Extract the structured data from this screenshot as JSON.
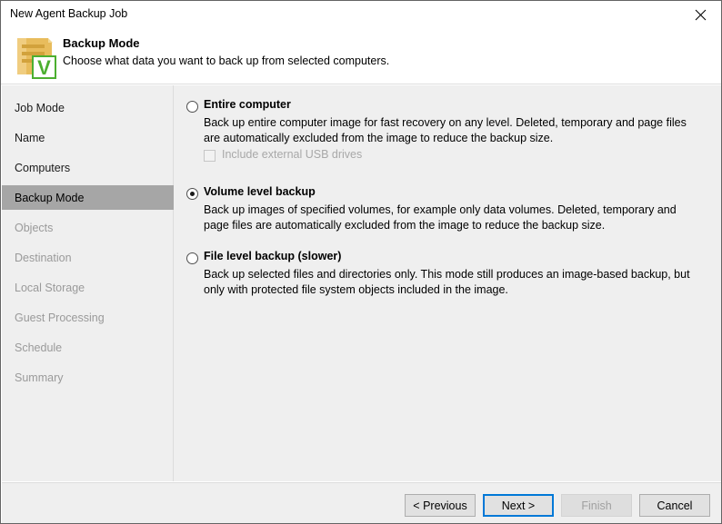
{
  "window": {
    "title": "New Agent Backup Job",
    "close_icon": "close-icon"
  },
  "header": {
    "icon": "document-veeam-icon",
    "title": "Backup Mode",
    "subtitle": "Choose what data you want to back up from selected computers."
  },
  "sidebar": {
    "items": [
      {
        "label": "Job Mode",
        "state": "done"
      },
      {
        "label": "Name",
        "state": "done"
      },
      {
        "label": "Computers",
        "state": "done"
      },
      {
        "label": "Backup Mode",
        "state": "active"
      },
      {
        "label": "Objects",
        "state": "upcoming"
      },
      {
        "label": "Destination",
        "state": "upcoming"
      },
      {
        "label": "Local Storage",
        "state": "upcoming"
      },
      {
        "label": "Guest Processing",
        "state": "upcoming"
      },
      {
        "label": "Schedule",
        "state": "upcoming"
      },
      {
        "label": "Summary",
        "state": "upcoming"
      }
    ]
  },
  "main": {
    "options": [
      {
        "id": "entire-computer",
        "title": "Entire computer",
        "description": "Back up entire computer image for fast recovery on any level. Deleted, temporary and page files are automatically excluded from the image to reduce the backup size.",
        "selected": false,
        "sub_checkbox": {
          "label": "Include external USB drives",
          "checked": false,
          "enabled": false
        }
      },
      {
        "id": "volume-level-backup",
        "title": "Volume level backup",
        "description": "Back up images of specified volumes, for example only data volumes. Deleted, temporary and page files are automatically excluded from the image to reduce the backup size.",
        "selected": true
      },
      {
        "id": "file-level-backup",
        "title": "File level backup (slower)",
        "description": "Back up selected files and directories only. This mode still produces an image-based backup, but only with protected file system objects included in the image.",
        "selected": false
      }
    ]
  },
  "footer": {
    "buttons": [
      {
        "id": "previous",
        "label": "< Previous",
        "state": "normal"
      },
      {
        "id": "next",
        "label": "Next >",
        "state": "default"
      },
      {
        "id": "finish",
        "label": "Finish",
        "state": "disabled"
      },
      {
        "id": "cancel",
        "label": "Cancel",
        "state": "normal"
      }
    ]
  },
  "colors": {
    "accent_blue": "#0078d7",
    "veeam_green": "#4caf30",
    "scroll_gray": "#a6a6a6",
    "panel_gray": "#efefef"
  }
}
